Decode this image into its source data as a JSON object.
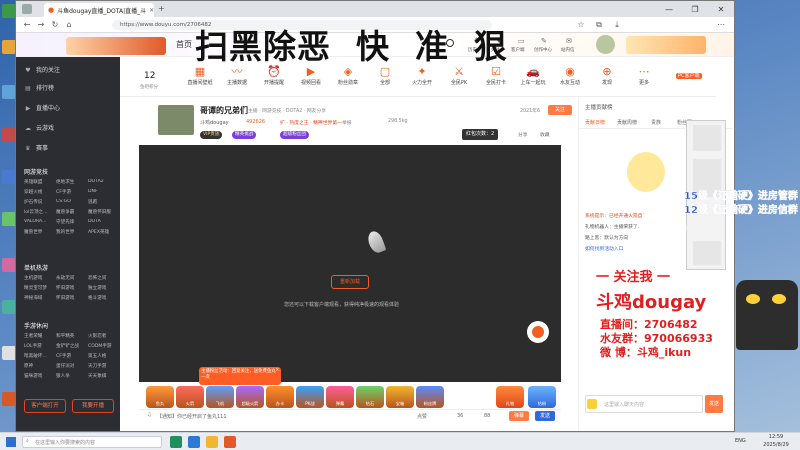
{
  "browser": {
    "tab_title": "斗鱼dougay直播_DOTA|直播_斗",
    "url": "https://www.douyu.com/2706482",
    "window_buttons": [
      "—",
      "❐",
      "✕"
    ]
  },
  "overlay": {
    "title": "扫黑除恶  快  准  狠",
    "promo_level_1": "15级《还黯硬》进房管群",
    "promo_level_2": "12级《还黯硬》进房信群",
    "follow_me": "一 关注我 一",
    "streamer_name": "斗鸡dougay",
    "room_label": "直播间：",
    "room_no": "2706482",
    "fans_label": "水友群：",
    "fans_no": "970066933",
    "weibo_label": "微  博：",
    "weibo_val": "斗鸡_ikun"
  },
  "site_nav": {
    "home": "首页",
    "right_icons": [
      "历史",
      "关注",
      "客户端",
      "创作中心",
      "站内信"
    ]
  },
  "sidebar": {
    "top_items": [
      "我的关注",
      "排行榜",
      "直播中心",
      "云游戏",
      "赛事"
    ],
    "section_game": "网游竞技",
    "game_grid": [
      [
        "英雄联盟",
        "绝地求生",
        "DOTA2"
      ],
      [
        "穿越火线",
        "CF手游",
        "DNF"
      ],
      [
        "炉石传说",
        "CS:GO",
        "逃跑"
      ],
      [
        "lol云顶之...",
        "魔兽争霸",
        "魔兽怀旧服"
      ],
      [
        "VALORA...",
        "守望先锋",
        "DOTA"
      ],
      [
        "魔兽世界",
        "我的世界",
        "APEX英雄"
      ]
    ],
    "section_single": "单机热游",
    "single_grid": [
      [
        "主机游戏",
        "永劫无间",
        "恐怖之间"
      ],
      [
        "精灵宝可梦",
        "怀旧游戏",
        "独立游戏"
      ],
      [
        "神秘海域",
        "怀旧游戏",
        "格斗游戏"
      ]
    ],
    "section_mobile": "手游休闲",
    "mobile_grid": [
      [
        "王者荣耀",
        "和平精英",
        "火影忍者"
      ],
      [
        "LOL手游",
        "金铲铲之战",
        "CODM手游"
      ],
      [
        "暗黑破坏...",
        "CF手游",
        "第五人格"
      ],
      [
        "原神",
        "蛋仔派对",
        "天刀手游"
      ],
      [
        "猫咪游戏",
        "狼人杀",
        "天天象棋"
      ]
    ],
    "btn_client": "客户端打开",
    "btn_live": "我要开播"
  },
  "categories": {
    "score_value": "12",
    "score_label": "鱼吧积分",
    "items": [
      "直播间壁纸",
      "主播数据",
      "开播提醒",
      "视频回看",
      "粉丝勋章",
      "全部",
      "火力全开",
      "全民PK",
      "全民打卡",
      "上车一起玩",
      "水友互动",
      "发现",
      "更多"
    ],
    "pc_client": "PC客户端"
  },
  "room": {
    "title": "哥谭的兄弟们",
    "channel_link": "主播 · 网游竞技 · DOTA2 · 网友分享",
    "anchor": "斗鸡dougay",
    "hot": "492626",
    "tag_report": "举报",
    "fans": "298.5kg",
    "rank_badge": "2021年6",
    "share": "分享",
    "follow": "关注",
    "hot_label": "每周热度",
    "note": "扩 · 热度之王 · 精神世界第一",
    "tags": [
      "VIP贵族",
      "精英挑战",
      "超级粉丝团"
    ],
    "cover_button": "红包次数：2",
    "collect": "收藏"
  },
  "player": {
    "center_button": "重新加载",
    "hint": "您还可以下载客户端观看，获得纯净极速的观看体验",
    "hint_link": "下载客户端"
  },
  "gifts": {
    "items": [
      "鱼丸",
      "火箭",
      "飞机",
      "超级火箭",
      "办卡",
      "PK战",
      "弹幕",
      "钻石",
      "宝箱",
      "粉丝牌"
    ],
    "popup_text": "主播粉丝活动：回复关注，送免费鱼丸一次",
    "popup_close": "✕",
    "right_items": [
      "礼物",
      "钻粉"
    ]
  },
  "danmu_bar": {
    "room_text": "【通知】你已经开启了鱼丸111",
    "likes_label": "点赞",
    "likes": "36",
    "views": "88",
    "danmu_btn": "弹幕",
    "send_btn": "发送"
  },
  "right_panel": {
    "rank_title": "主播贡献榜",
    "tabs": [
      "贡献日榜",
      "贡献周榜",
      "贵族",
      "粉丝团"
    ],
    "chat_lines": [
      "系统提示：已经开通火箭自动抢",
      "礼物机器人：主播荣获了...",
      "路上客：默认为方向",
      "如何找到活动入口"
    ],
    "chat_placeholder": "这里输入聊天内容",
    "send": "发送"
  },
  "taskbar": {
    "search_placeholder": "在这里输入你要搜索的内容",
    "lang": "ENG",
    "time": "12:59",
    "date": "2025/8/29"
  },
  "colors": {
    "accent": "#ff5d23",
    "sidebar_bg": "#2b2d33",
    "player_bg": "#2c2c2c",
    "promo_blue": "#1a49c4",
    "promo_red": "#e11f1f"
  }
}
